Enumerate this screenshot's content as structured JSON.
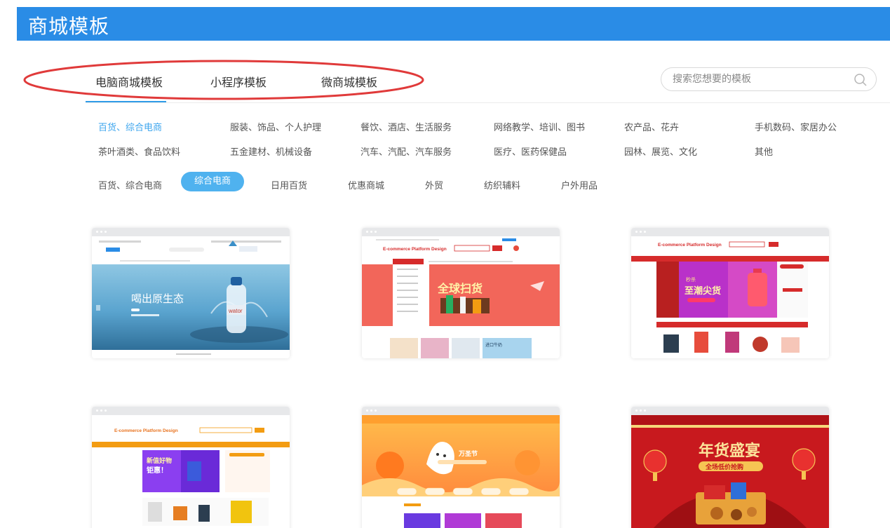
{
  "header": {
    "title": "商城模板"
  },
  "tabs": [
    {
      "label": "电脑商城模板"
    },
    {
      "label": "小程序模板"
    },
    {
      "label": "微商城模板"
    }
  ],
  "search": {
    "placeholder": "搜索您想要的模板",
    "value": ""
  },
  "categories": {
    "row1": [
      "百货、综合电商",
      "服装、饰品、个人护理",
      "餐饮、酒店、生活服务",
      "网络教学、培训、图书",
      "农产品、花卉",
      "手机数码、家居办公"
    ],
    "row2": [
      "茶叶酒类、食品饮料",
      "五金建材、机械设备",
      "汽车、汽配、汽车服务",
      "医疗、医药保健品",
      "园林、展览、文化",
      "其他"
    ]
  },
  "subcategories": [
    "百货、综合电商",
    "综合电商",
    "日用百货",
    "优惠商城",
    "外贸",
    "纺织辅料",
    "户外用品"
  ],
  "templates": [
    {
      "theme": "water",
      "headline": "喝出原生态",
      "brand": "wator"
    },
    {
      "theme": "global",
      "logo": "E-commerce Platform Design",
      "headline": "全球扫货",
      "promo": "进口牛奶"
    },
    {
      "theme": "fashion",
      "logo": "E-commerce Platform Design",
      "headline": "至潮尖货",
      "sub": "秒杀"
    },
    {
      "theme": "goods",
      "logo": "E-commerce Platform Design",
      "headline": "新值好物",
      "sub": "钜惠！"
    },
    {
      "theme": "halloween",
      "headline": "万圣节"
    },
    {
      "theme": "newyear",
      "headline": "年货盛宴",
      "sub": "全场低价抢购"
    }
  ],
  "colors": {
    "banner": "#2a8ce6",
    "accent": "#3ea6ee",
    "pill": "#4fb2ef",
    "annotation": "#e03a3a"
  }
}
